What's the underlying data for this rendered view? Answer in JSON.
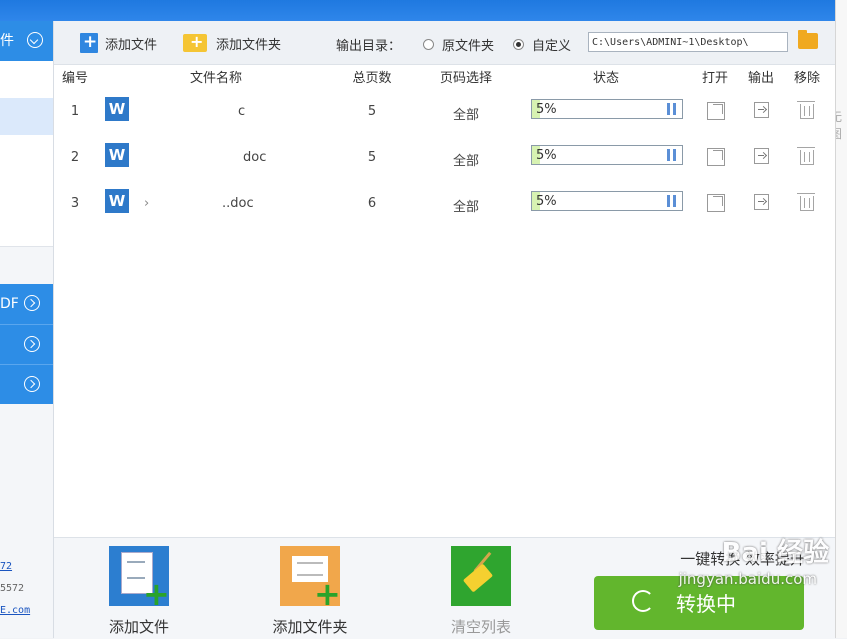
{
  "sidebar": {
    "category_top": "件",
    "category_2": "DF",
    "footer_lines": [
      "72",
      "5572",
      "E.com"
    ]
  },
  "rightstrip_text": "无图",
  "toolbar": {
    "add_file": "添加文件",
    "add_folder": "添加文件夹",
    "output_label": "输出目录：",
    "radio_original": "原文件夹",
    "radio_custom": "自定义",
    "output_path": "C:\\Users\\ADMINI~1\\Desktop\\"
  },
  "table": {
    "headers": [
      "编号",
      "文件名称",
      "总页数",
      "页码选择",
      "状态",
      "打开",
      "输出",
      "移除"
    ],
    "rows": [
      {
        "no": "1",
        "name": "c",
        "pages": "5",
        "range": "全部",
        "progress": "5%"
      },
      {
        "no": "2",
        "name": "doc",
        "pages": "5",
        "range": "全部",
        "progress": "5%"
      },
      {
        "no": "3",
        "name": "..doc",
        "pages": "6",
        "range": "全部",
        "progress": "5%"
      }
    ],
    "progress_fraction": 0.05,
    "row3_extra": "›"
  },
  "bottom": {
    "add_file": "添加文件",
    "add_folder": "添加文件夹",
    "clear_list": "清空列表",
    "slogan": "一键转换 效率提升",
    "convert": "转换中"
  },
  "watermark": {
    "brand": "Bai 经验",
    "url": "jingyan.baidu.com"
  },
  "colors": {
    "accent": "#2d8de6",
    "progress_fill": "#d7f2b2",
    "convert_green": "#62b62d"
  }
}
